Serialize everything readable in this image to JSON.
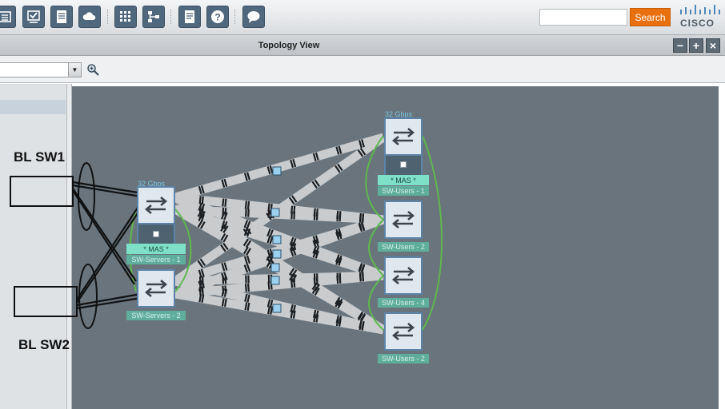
{
  "toolbar": {
    "icons": [
      "list-icon",
      "checklist-icon",
      "notes-icon",
      "cloud-icon",
      "grid-icon",
      "hierarchy-icon",
      "document-icon",
      "help-icon",
      "chat-icon"
    ],
    "search_placeholder": "",
    "search_label": "Search",
    "brand": "CISCO"
  },
  "window": {
    "title": "Topology View",
    "minimize": "−",
    "maximize": "+",
    "close": "×"
  },
  "subbar": {
    "combo_value": ""
  },
  "topology": {
    "left_stack": {
      "bandwidth": "32 Gbps",
      "master": "* MAS *",
      "switch_1": "SW-Servers - 1",
      "switch_2": "SW-Servers - 2"
    },
    "right_stack": {
      "bandwidth": "32 Gbps",
      "master": "* MAS *",
      "switch_1": "SW-Users - 1",
      "switch_2": "SW-Users - 2",
      "switch_3": "SW-Users - 4",
      "switch_4": "SW-Users - 2"
    }
  },
  "annotations": {
    "top": "BL SW1",
    "bottom": "BL SW2"
  },
  "colors": {
    "canvas": "#69747c",
    "link": "#c9cbcd",
    "stack_link": "#5fb84f",
    "accent": "#e8700f"
  }
}
